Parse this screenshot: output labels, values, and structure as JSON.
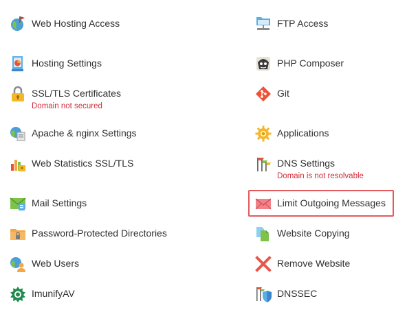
{
  "left_column": [
    {
      "icon": "globe-user-icon",
      "label": "Web Hosting Access"
    },
    {
      "icon": "hosting-settings-icon",
      "label": "Hosting Settings"
    },
    {
      "icon": "lock-icon",
      "label": "SSL/TLS Certificates",
      "warning": "Domain not secured"
    },
    {
      "icon": "apache-nginx-icon",
      "label": "Apache & nginx Settings"
    },
    {
      "icon": "statistics-chart-icon",
      "label": "Web Statistics SSL/TLS"
    },
    {
      "icon": "mail-settings-icon",
      "label": "Mail Settings"
    },
    {
      "icon": "protected-folder-icon",
      "label": "Password-Protected Directories"
    },
    {
      "icon": "web-users-icon",
      "label": "Web Users"
    },
    {
      "icon": "imunifyav-icon",
      "label": "ImunifyAV"
    }
  ],
  "right_column": [
    {
      "icon": "ftp-icon",
      "label": "FTP Access"
    },
    {
      "icon": "php-composer-icon",
      "label": "PHP Composer"
    },
    {
      "icon": "git-icon",
      "label": "Git"
    },
    {
      "icon": "gear-icon",
      "label": "Applications"
    },
    {
      "icon": "dns-flags-icon",
      "label": "DNS Settings",
      "warning": "Domain is not resolvable"
    },
    {
      "icon": "envelope-icon",
      "label": "Limit Outgoing Messages"
    },
    {
      "icon": "copy-documents-icon",
      "label": "Website Copying"
    },
    {
      "icon": "remove-x-icon",
      "label": "Remove Website"
    },
    {
      "icon": "dnssec-shield-icon",
      "label": "DNSSEC"
    }
  ],
  "colors": {
    "text": "#303030",
    "warning": "#d02d3b",
    "highlight_border": "#e05a5e"
  }
}
